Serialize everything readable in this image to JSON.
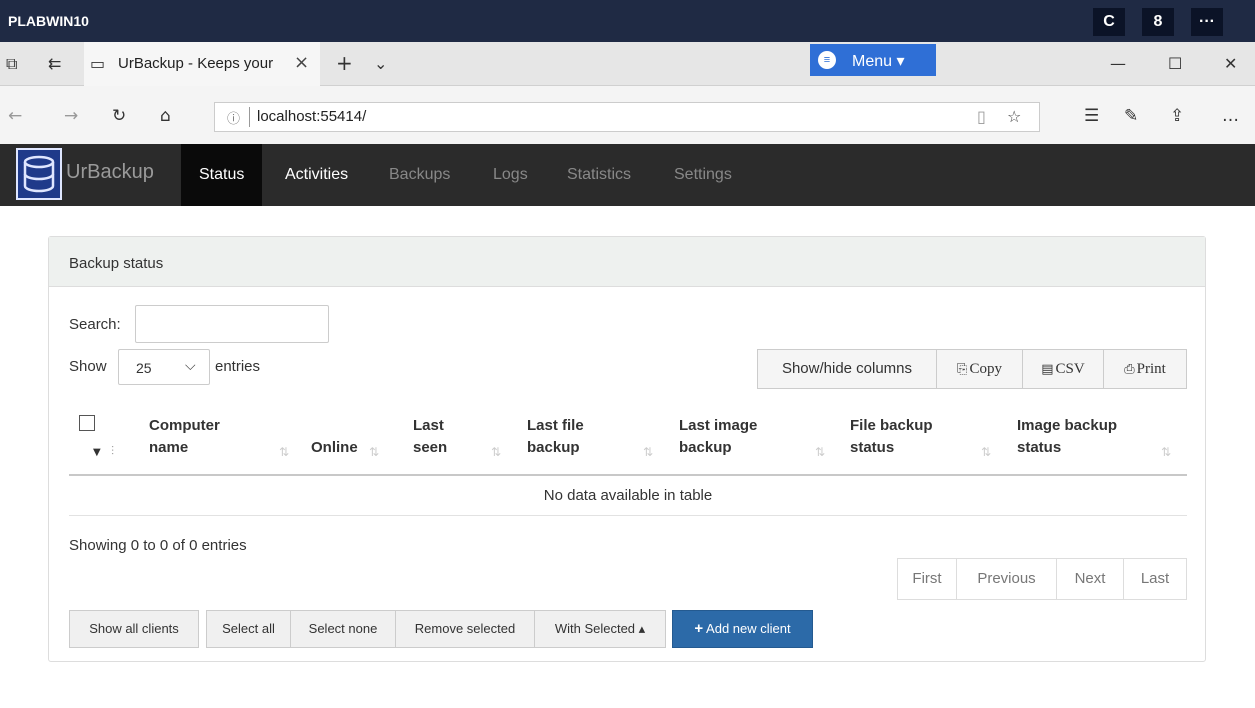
{
  "remote": {
    "title": "PLABWIN10",
    "buttons": [
      "C",
      "8",
      "···"
    ]
  },
  "browser": {
    "tab_title": "UrBackup - Keeps your",
    "menu_label": "Menu ▾",
    "url": "localhost:55414/",
    "window_controls": [
      "—",
      "☐",
      "✕"
    ]
  },
  "app": {
    "brand": "UrBackup",
    "nav": [
      {
        "label": "Status",
        "active": true
      },
      {
        "label": "Activities",
        "active": false
      },
      {
        "label": "Backups",
        "active": false
      },
      {
        "label": "Logs",
        "active": false
      },
      {
        "label": "Statistics",
        "active": false
      },
      {
        "label": "Settings",
        "active": false
      }
    ]
  },
  "panel": {
    "title": "Backup status",
    "search_label": "Search:",
    "search_value": "",
    "show_label": "Show",
    "entries_value": "25",
    "entries_label": "entries",
    "tools": {
      "columns": "Show/hide columns",
      "copy": "Copy",
      "csv": "CSV",
      "print": "Print"
    },
    "columns": [
      {
        "line1": "Computer",
        "line2": "name"
      },
      {
        "line1": "",
        "line2": "Online"
      },
      {
        "line1": "Last",
        "line2": "seen"
      },
      {
        "line1": "Last file",
        "line2": "backup"
      },
      {
        "line1": "Last image",
        "line2": "backup"
      },
      {
        "line1": "File backup",
        "line2": "status"
      },
      {
        "line1": "Image backup",
        "line2": "status"
      }
    ],
    "empty_message": "No data available in table",
    "info": "Showing 0 to 0 of 0 entries",
    "pager": {
      "first": "First",
      "previous": "Previous",
      "next": "Next",
      "last": "Last"
    },
    "actions": {
      "show_all": "Show all clients",
      "select_all": "Select all",
      "select_none": "Select none",
      "remove_selected": "Remove selected",
      "with_selected": "With Selected ▴",
      "add_client": "Add new client"
    }
  },
  "colors": {
    "navbar": "#2b2b2b",
    "primary": "#2c6aa8",
    "menu": "#2f6fd6",
    "remote_bar": "#1f2a44"
  }
}
